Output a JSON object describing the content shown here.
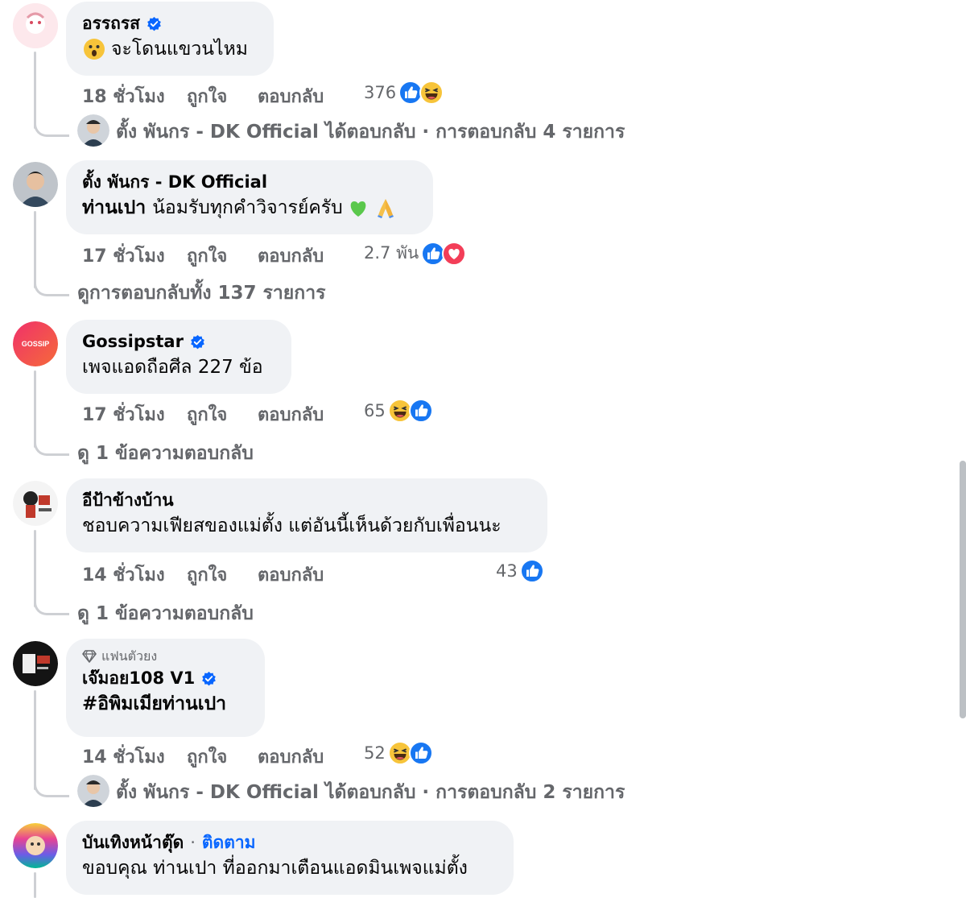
{
  "comments": [
    {
      "author": "อรรถรส",
      "text": "จะโดนแขวนไหม",
      "time": "18 ชั่วโมง",
      "like_label": "ถูกใจ",
      "reply_label": "ตอบกลับ",
      "reaction_count": "376",
      "reactions": [
        "like-icon",
        "haha-icon"
      ],
      "reply_summary": {
        "replier": "ตั้ง พันกร - DK Official",
        "text": "ได้ตอบกลับ · การตอบกลับ 4 รายการ"
      }
    },
    {
      "author": "ตั้ง พันกร - DK Official",
      "text_bold": "ท่านเปา",
      "text": "น้อมรับทุกคำวิจารย์ครับ",
      "emoji": [
        "green-heart-icon",
        "folded-hands-icon"
      ],
      "time": "17 ชั่วโมง",
      "like_label": "ถูกใจ",
      "reply_label": "ตอบกลับ",
      "reaction_count": "2.7 พัน",
      "reactions": [
        "like-icon",
        "love-icon"
      ],
      "view_replies": "ดูการตอบกลับทั้ง 137 รายการ"
    },
    {
      "author": "Gossipstar",
      "avatar_text": "GOSSIP",
      "text": "เพจแอดถือศีล 227 ข้อ",
      "time": "17 ชั่วโมง",
      "like_label": "ถูกใจ",
      "reply_label": "ตอบกลับ",
      "reaction_count": "65",
      "reactions": [
        "haha-icon",
        "like-icon"
      ],
      "view_replies": "ดู 1 ข้อความตอบกลับ"
    },
    {
      "author": "อีป้าข้างบ้าน",
      "text": "ชอบความเฟียสของแม่ตั้ง แต่อันนี้เห็นด้วยกับเพื่อนนะ",
      "time": "14 ชั่วโมง",
      "like_label": "ถูกใจ",
      "reply_label": "ตอบกลับ",
      "reaction_count": "43",
      "reactions": [
        "like-icon"
      ],
      "view_replies": "ดู 1 ข้อความตอบกลับ"
    },
    {
      "badge": "แฟนตัวยง",
      "author": "เจ๊มอย108 V1",
      "text": "#อิพิมเมียท่านเปา",
      "time": "14 ชั่วโมง",
      "like_label": "ถูกใจ",
      "reply_label": "ตอบกลับ",
      "reaction_count": "52",
      "reactions": [
        "haha-icon",
        "like-icon"
      ],
      "reply_summary": {
        "replier": "ตั้ง พันกร - DK Official",
        "text": "ได้ตอบกลับ · การตอบกลับ 2 รายการ"
      }
    },
    {
      "author": "บันเทิงหน้าตุ๊ด",
      "separator": "·",
      "follow_label": "ติดตาม",
      "text": "ขอบคุณ ท่านเปา ที่ออกมาเตือนแอดมินเพจแม่ตั้ง"
    }
  ],
  "colors": {
    "bubble_bg": "#f0f2f5",
    "meta_text": "#65676b",
    "link_blue": "#0866ff",
    "thread_line": "#ced0d4"
  }
}
